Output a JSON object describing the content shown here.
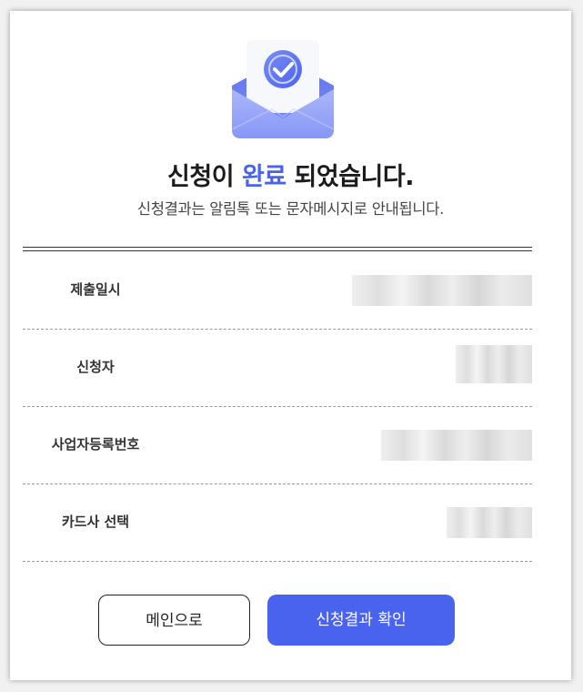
{
  "header": {
    "title_pre": "신청이 ",
    "title_accent": "완료",
    "title_post": " 되었습니다.",
    "subtitle": "신청결과는 알림톡 또는 문자메시지로 안내됩니다."
  },
  "colors": {
    "accent": "#4a63ee",
    "text": "#1b1b1b"
  },
  "icon": {
    "name": "envelope-check-icon"
  },
  "details": [
    {
      "label": "제출일시",
      "value_redacted": true
    },
    {
      "label": "신청자",
      "value_redacted": true
    },
    {
      "label": "사업자등록번호",
      "value_redacted": true
    },
    {
      "label": "카드사 선택",
      "value_redacted": true
    }
  ],
  "actions": {
    "main_label": "메인으로",
    "confirm_label": "신청결과 확인"
  }
}
